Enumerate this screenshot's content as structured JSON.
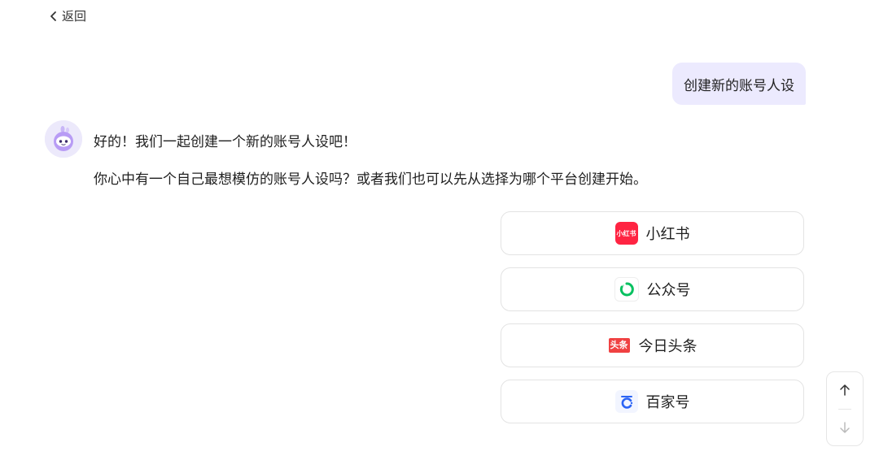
{
  "nav": {
    "back_label": "返回",
    "back_icon": "chevron-left-icon"
  },
  "conversation": {
    "user_message": "创建新的账号人设",
    "bot_avatar_icon": "robot-avatar-icon",
    "bot_line_1": "好的！我们一起创建一个新的账号人设吧！",
    "bot_line_2": "你心中有一个自己最想模仿的账号人设吗？或者我们也可以先从选择为哪个平台创建开始。"
  },
  "platforms": [
    {
      "label": "小红书",
      "icon": "xiaohongshu-logo-icon",
      "logo_text": "小红书",
      "color": "#ff2442"
    },
    {
      "label": "公众号",
      "icon": "wechat-official-account-logo-icon",
      "color": "#07c160"
    },
    {
      "label": "今日头条",
      "icon": "toutiao-logo-icon",
      "logo_text": "头条",
      "color": "#f04142"
    },
    {
      "label": "百家号",
      "icon": "baijiahao-logo-icon",
      "color": "#2b64f5"
    }
  ],
  "scroll": {
    "up_icon": "arrow-up-icon",
    "down_icon": "arrow-down-icon"
  }
}
